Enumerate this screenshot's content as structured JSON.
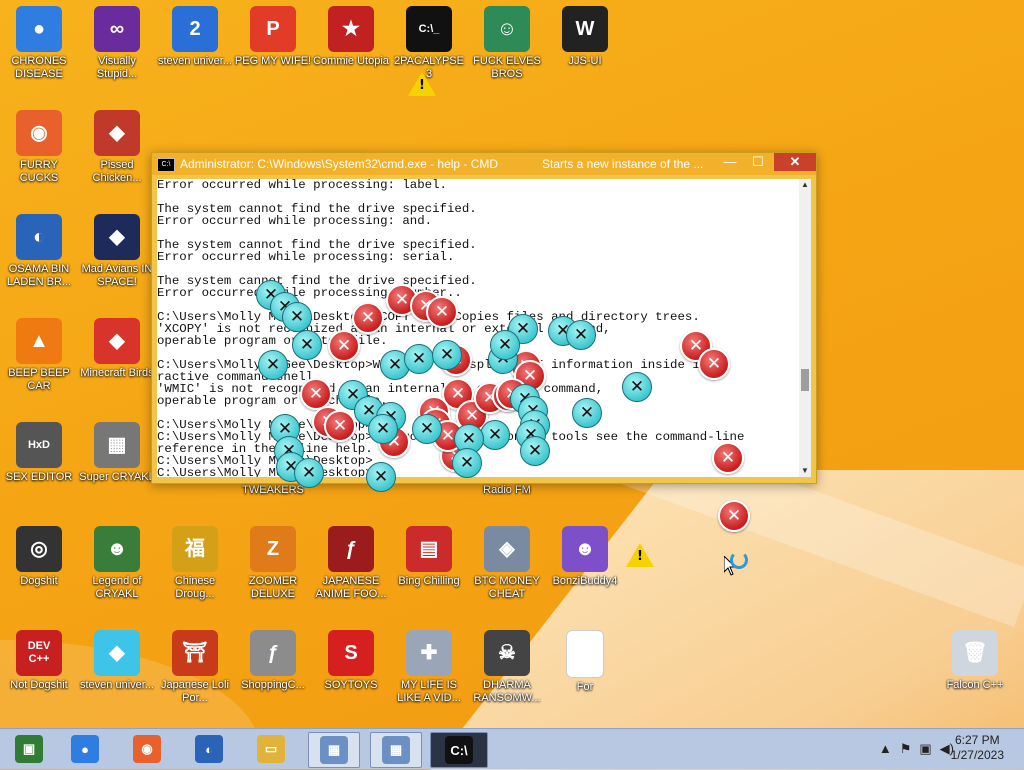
{
  "desktop": {
    "icons": [
      {
        "label": "CHRONES DISEASE",
        "glyph": "●",
        "color": "#2f7de1",
        "icon": "chrome-icon"
      },
      {
        "label": "Visually Stupid...",
        "glyph": "∞",
        "color": "#6a2c9c",
        "icon": "visual-studio-icon"
      },
      {
        "label": "steven univer...",
        "glyph": "2",
        "color": "#2a6fd8",
        "icon": "gem-icon"
      },
      {
        "label": "PEG MY WIFE!",
        "glyph": "P",
        "color": "#e23c28",
        "icon": "peggle-icon"
      },
      {
        "label": "Commie Utopia",
        "glyph": "★",
        "color": "#c22121",
        "icon": "hammer-sickle-icon"
      },
      {
        "label": "2PACALYPSE 3",
        "glyph": "C:\\_",
        "color": "#111111",
        "icon": "console-icon"
      },
      {
        "label": "FUCK ELVES BROS",
        "glyph": "☺",
        "color": "#2e8b57",
        "icon": "elf-icon"
      },
      {
        "label": "JJS-UI",
        "glyph": "W",
        "color": "#222222",
        "icon": "ui-logo-icon"
      },
      {
        "label": "FURRY CUCKS",
        "glyph": "◉",
        "color": "#e8612c",
        "icon": "firefox-icon"
      },
      {
        "label": "Pissed Chicken...",
        "glyph": "◆",
        "color": "#c0392b",
        "icon": "angry-bird-seasons-icon"
      },
      {
        "label": "OSAMA BIN LADEN BR...",
        "glyph": "◐",
        "color": "#2a64b8",
        "icon": "obama-logo-icon"
      },
      {
        "label": "Mad Avians IN SPACE!",
        "glyph": "◆",
        "color": "#1e2a5a",
        "icon": "angry-birds-space-icon"
      },
      {
        "label": "BEEP BEEP CAR",
        "glyph": "▲",
        "color": "#f07a12",
        "icon": "vlc-cone-icon"
      },
      {
        "label": "Minecraft Birds",
        "glyph": "◆",
        "color": "#d9342b",
        "icon": "angry-bird-icon"
      },
      {
        "label": "SEX EDITOR",
        "glyph": "HxD",
        "color": "#555555",
        "icon": "hex-editor-icon"
      },
      {
        "label": "Super CRYAKL",
        "glyph": "▦",
        "color": "#777777",
        "icon": "pixel-cat-icon"
      },
      {
        "label": "TWEAKERS",
        "glyph": "",
        "color": "transparent",
        "icon": "hidden-icon"
      },
      {
        "label": "Radio FM",
        "glyph": "",
        "color": "transparent",
        "icon": "hidden-icon"
      },
      {
        "label": "Dogshit",
        "glyph": "◎",
        "color": "#333333",
        "icon": "disc-icon"
      },
      {
        "label": "Legend of CRYAKL",
        "glyph": "☻",
        "color": "#3a7d3a",
        "icon": "ninja-icon"
      },
      {
        "label": "Chinese Droug...",
        "glyph": "福",
        "color": "#d4a017",
        "icon": "mahjong-icon"
      },
      {
        "label": "ZOOMER DELUXE",
        "glyph": "Z",
        "color": "#e07b1a",
        "icon": "zuma-icon"
      },
      {
        "label": "JAPANESE ANIME FOO...",
        "glyph": "ƒ",
        "color": "#9b1c1c",
        "icon": "flash-icon"
      },
      {
        "label": "Bing Chilling",
        "glyph": "▤",
        "color": "#cc2b2b",
        "icon": "book-icon"
      },
      {
        "label": "BTC MONEY CHEAT",
        "glyph": "◈",
        "color": "#7a8aa0",
        "icon": "btc-cube-icon"
      },
      {
        "label": "BonziBuddy4",
        "glyph": "☻",
        "color": "#7d4fc9",
        "icon": "bonzi-icon"
      },
      {
        "label": "Not Dogshit",
        "glyph": "DEV C++",
        "color": "#c62020",
        "icon": "devcpp-icon"
      },
      {
        "label": "steven univer...",
        "glyph": "◆",
        "color": "#3ec4e8",
        "icon": "diamond-icon"
      },
      {
        "label": "Japanese Loli Por...",
        "glyph": "⛩",
        "color": "#c73a1a",
        "icon": "torii-icon"
      },
      {
        "label": "ShoppingC...",
        "glyph": "ƒ",
        "color": "#8c8c8c",
        "icon": "flash-gray-icon"
      },
      {
        "label": "SOYTOYS",
        "glyph": "S",
        "color": "#d61f1f",
        "icon": "soytoys-icon"
      },
      {
        "label": "MY LIFE IS LIKE A VID...",
        "glyph": "✚",
        "color": "#9aa6b8",
        "icon": "gamepad-icon"
      },
      {
        "label": "DHARMA RANSOMW...",
        "glyph": "☠",
        "color": "#444444",
        "icon": "skull-icon"
      },
      {
        "label": "For",
        "glyph": "",
        "color": "#ffffff",
        "icon": "blank-file-icon"
      },
      {
        "label": "Falcon C++",
        "glyph": "🗑",
        "color": "#cfd6de",
        "icon": "recycle-bin-icon"
      }
    ]
  },
  "cmd": {
    "title": "Administrator: C:\\Windows\\System32\\cmd.exe - help - CMD",
    "tooltip": "Starts a new instance of the ...",
    "lines": [
      "Error occurred while processing: label.",
      "",
      "The system cannot find the drive specified.",
      "Error occurred while processing: and.",
      "",
      "The system cannot find the drive specified.",
      "Error occurred while processing: serial.",
      "",
      "The system cannot find the drive specified.",
      "Error occurred while processing: number..",
      "",
      "C:\\Users\\Molly McGee\\Desktop>XCOPY      Copies files and directory trees.",
      "'XCOPY' is not recognized as an internal or external command,",
      "operable program or batch file.",
      "",
      "C:\\Users\\Molly McGee\\Desktop>WMIC       Displays WMI information inside inte",
      "ractive command shell.",
      "'WMIC' is not recognized as an internal or external command,",
      "operable program or batch file.",
      "",
      "C:\\Users\\Molly McGee\\Desktop>",
      "C:\\Users\\Molly McGee\\Desktop>For more information on tools see the command-line",
      "reference in the online help.",
      "C:\\Users\\Molly McGee\\Desktop>",
      "C:\\Users\\Molly McGee\\Desktop>"
    ]
  },
  "taskbar": {
    "items": [
      {
        "icon": "chrome-grid-icon",
        "glyph": "▣",
        "color": "#2e7d32"
      },
      {
        "icon": "chrome-icon",
        "glyph": "●",
        "color": "#2f7de1"
      },
      {
        "icon": "firefox-icon",
        "glyph": "◉",
        "color": "#e8612c"
      },
      {
        "icon": "obama-logo-icon",
        "glyph": "◐",
        "color": "#2a64b8"
      },
      {
        "icon": "file-explorer-icon",
        "glyph": "▭",
        "color": "#e2b33a"
      },
      {
        "icon": "network-icon-1",
        "glyph": "▦",
        "color": "#6c8fc4"
      },
      {
        "icon": "network-icon-2",
        "glyph": "▦",
        "color": "#6c8fc4"
      },
      {
        "icon": "cmd-icon",
        "glyph": "C:\\",
        "color": "#111111"
      }
    ],
    "clock_time": "6:27 PM",
    "clock_date": "1/27/2023",
    "tray": [
      "▲",
      "⚑",
      "▣",
      "◀)"
    ]
  }
}
